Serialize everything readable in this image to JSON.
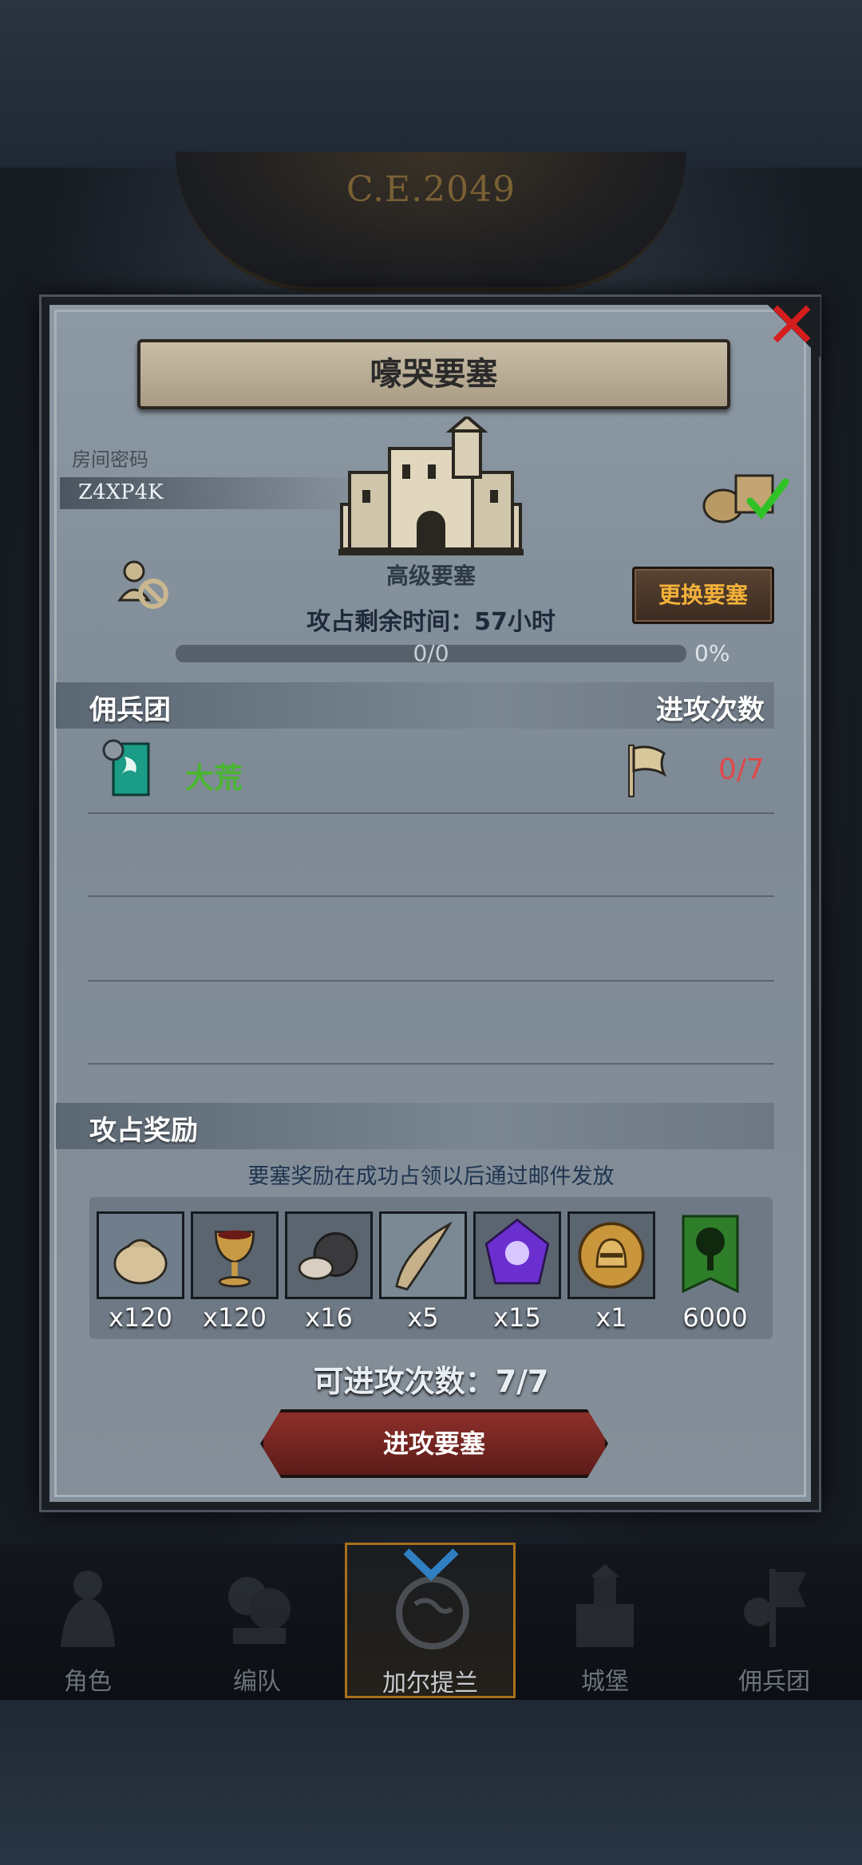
{
  "background": {
    "era_label": "C.E.2049"
  },
  "modal": {
    "title": "嚎哭要塞",
    "room_label": "房间密码",
    "room_code": "Z4XP4K",
    "castle_name": "高级要塞",
    "change_button": "更换要塞",
    "timer_label": "攻占剩余时间：",
    "timer_value": "57小时",
    "progress": {
      "count": "0/0",
      "percent": "0%",
      "fraction": 0
    },
    "mercenary_section": "佣兵团",
    "attacks_section": "进攻次数",
    "mercenary_row": {
      "name": "大荒",
      "attacks": "0/7"
    },
    "reward_section": "攻占奖励",
    "reward_note": "要塞奖励在成功占领以后通过邮件发放",
    "rewards": [
      {
        "icon": "sack-icon",
        "qty": "x120"
      },
      {
        "icon": "goblet-icon",
        "qty": "x120"
      },
      {
        "icon": "ore-icon",
        "qty": "x16"
      },
      {
        "icon": "horn-icon",
        "qty": "x5"
      },
      {
        "icon": "purple-gem-icon",
        "qty": "x15"
      },
      {
        "icon": "gold-helmet-coin-icon",
        "qty": "x1"
      },
      {
        "icon": "tree-banner-icon",
        "qty": "6000"
      }
    ],
    "available_attacks": "可进攻次数：7/7",
    "attack_button": "进攻要塞"
  },
  "nav": [
    {
      "label": "角色"
    },
    {
      "label": "编队"
    },
    {
      "label": "加尔提兰"
    },
    {
      "label": "城堡"
    },
    {
      "label": "佣兵团"
    }
  ],
  "colors": {
    "accent_gold": "#f2b13a",
    "mercenary_green": "#49b52f",
    "attack_red": "#e04848",
    "close_red": "#d51d1d"
  }
}
